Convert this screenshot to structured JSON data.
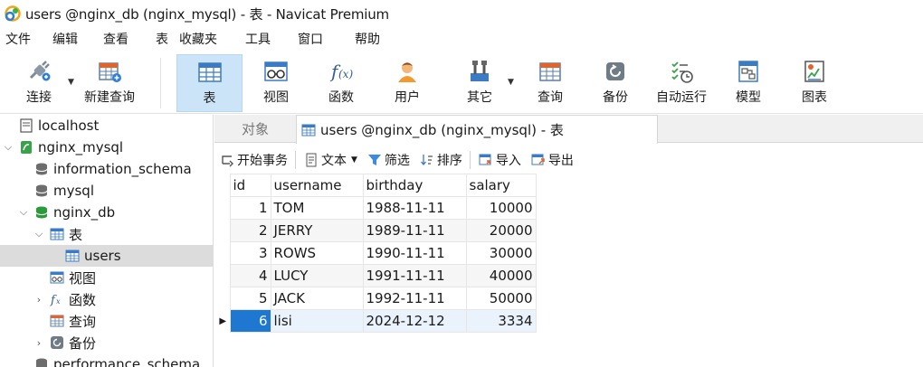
{
  "window": {
    "title": "users @nginx_db (nginx_mysql) - 表 - Navicat Premium"
  },
  "menu": [
    "文件",
    "编辑",
    "查看",
    "表",
    "收藏夹",
    "工具",
    "窗口",
    "帮助"
  ],
  "toolbar": {
    "buttons": [
      {
        "label": "连接",
        "icon": "connect-plug-icon"
      },
      {
        "label": "新建查询",
        "icon": "new-query-icon"
      },
      {
        "label": "表",
        "icon": "table-icon",
        "active": true
      },
      {
        "label": "视图",
        "icon": "view-icon"
      },
      {
        "label": "函数",
        "icon": "function-icon"
      },
      {
        "label": "用户",
        "icon": "user-icon"
      },
      {
        "label": "其它",
        "icon": "tools-icon"
      },
      {
        "label": "查询",
        "icon": "query-icon"
      },
      {
        "label": "备份",
        "icon": "backup-icon"
      },
      {
        "label": "自动运行",
        "icon": "auto-run-icon"
      },
      {
        "label": "模型",
        "icon": "model-icon"
      },
      {
        "label": "图表",
        "icon": "chart-icon"
      }
    ]
  },
  "sidebar": {
    "items": [
      {
        "label": "localhost",
        "icon": "server-icon"
      },
      {
        "label": "nginx_mysql",
        "icon": "mysql-connection-icon"
      },
      {
        "label": "information_schema",
        "icon": "database-icon"
      },
      {
        "label": "mysql",
        "icon": "database-icon"
      },
      {
        "label": "nginx_db",
        "icon": "database-open-icon"
      },
      {
        "label": "表",
        "icon": "table-icon"
      },
      {
        "label": "users",
        "icon": "table-icon"
      },
      {
        "label": "视图",
        "icon": "view-icon"
      },
      {
        "label": "函数",
        "icon": "function-icon"
      },
      {
        "label": "查询",
        "icon": "query-icon"
      },
      {
        "label": "备份",
        "icon": "backup-icon"
      },
      {
        "label": "performance_schema",
        "icon": "database-icon"
      }
    ]
  },
  "tabs": {
    "objects": "对象",
    "active": "users @nginx_db (nginx_mysql) - 表"
  },
  "subtoolbar": {
    "begin_transaction": "开始事务",
    "text": "文本",
    "filter": "筛选",
    "sort": "排序",
    "import": "导入",
    "export": "导出"
  },
  "grid": {
    "columns": [
      "id",
      "username",
      "birthday",
      "salary"
    ],
    "rows": [
      [
        "1",
        "TOM",
        "1988-11-11",
        "10000"
      ],
      [
        "2",
        "JERRY",
        "1989-11-11",
        "20000"
      ],
      [
        "3",
        "ROWS",
        "1990-11-11",
        "30000"
      ],
      [
        "4",
        "LUCY",
        "1991-11-11",
        "40000"
      ],
      [
        "5",
        "JACK",
        "1992-11-11",
        "50000"
      ],
      [
        "6",
        "lisi",
        "2024-12-12",
        "3334"
      ]
    ]
  },
  "colors": {
    "accent": "#1e78d2",
    "toolbar_active": "#cce4f7",
    "selected_tree": "#dcdcdc"
  }
}
